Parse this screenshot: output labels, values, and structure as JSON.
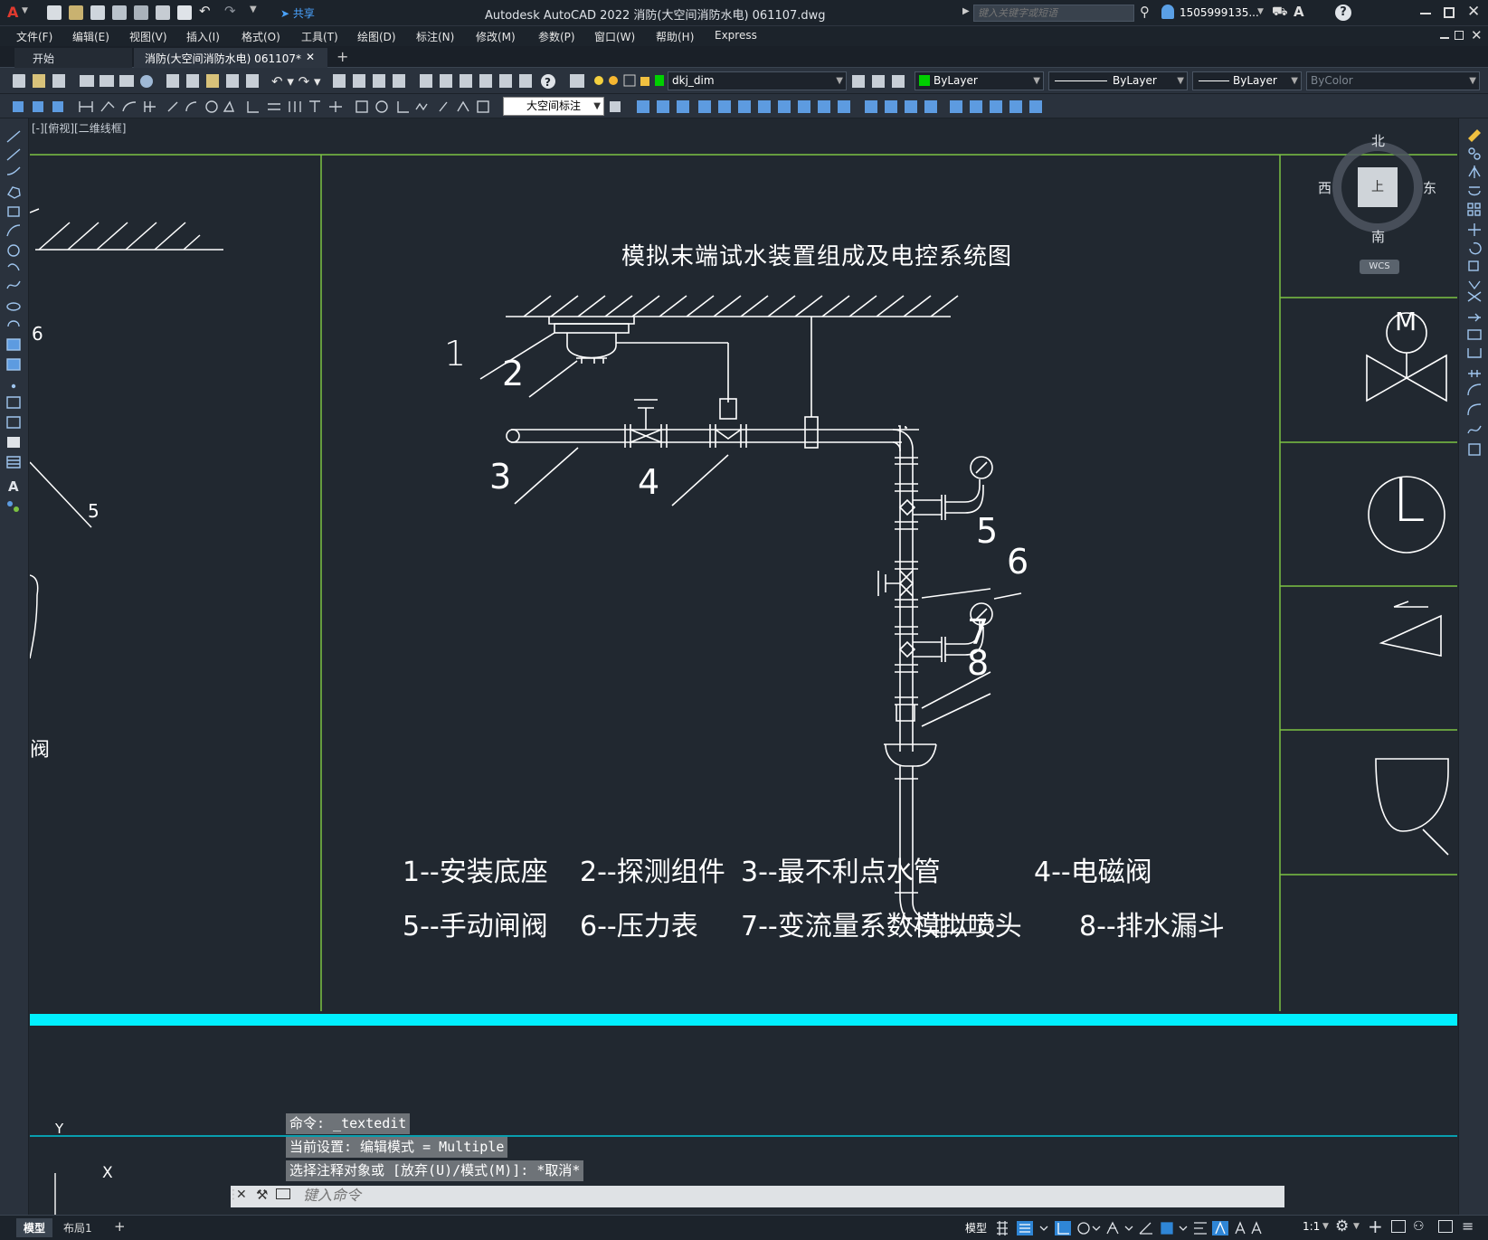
{
  "titlebar": {
    "app_letter": "A",
    "share": "共享",
    "title": "Autodesk AutoCAD 2022    消防(大空间消防水电) 061107.dwg",
    "search_placeholder": "键入关键字或短语",
    "user": "1505999135...",
    "help": "?"
  },
  "menu": [
    "文件(F)",
    "编辑(E)",
    "视图(V)",
    "插入(I)",
    "格式(O)",
    "工具(T)",
    "绘图(D)",
    "标注(N)",
    "修改(M)",
    "参数(P)",
    "窗口(W)",
    "帮助(H)",
    "Express"
  ],
  "tabs": {
    "start": "开始",
    "doc": "消防(大空间消防水电) 061107*",
    "close": "✕",
    "add": "+"
  },
  "toolbar": {
    "layer": "dkj_dim",
    "color": "ByLayer",
    "linetype": "ByLayer",
    "lineweight": "ByLayer",
    "plotstyle": "ByColor",
    "dimstyle": "大空间标注"
  },
  "viewport_label": "[-][俯视][二维线框]",
  "viewcube": {
    "north": "北",
    "south": "南",
    "east": "东",
    "west": "西",
    "top": "上",
    "wcs": "WCS"
  },
  "drawing": {
    "title": "模拟末端试水装置组成及电控系统图",
    "callouts": [
      "1",
      "2",
      "3",
      "4",
      "5",
      "6",
      "7",
      "8"
    ],
    "legend_row1": [
      "1--安装底座",
      "2--探测组件",
      "3--最不利点水管",
      "4--电磁阀"
    ],
    "legend_row2": [
      "5--手动闸阀",
      "6--压力表",
      "7--变流量系数模拟喷头",
      "8--排水漏斗"
    ],
    "left_fragment_numbers": [
      "6",
      "5"
    ],
    "left_fragment_text": "阀",
    "side_symbols": {
      "motor": "M",
      "level": "L"
    }
  },
  "ucs": {
    "x": "X",
    "y": "Y"
  },
  "command": {
    "history": [
      "命令: _textedit",
      "当前设置: 编辑模式 = Multiple",
      "选择注释对象或 [放弃(U)/模式(M)]: *取消*"
    ],
    "placeholder": "键入命令"
  },
  "status": {
    "tabs": [
      "模型",
      "布局1"
    ],
    "add": "+",
    "mode": "模型",
    "scale": "1:1"
  },
  "colors": {
    "green": "#7cc242",
    "cyan": "#00f0ff",
    "layer_green": "#00d000"
  }
}
